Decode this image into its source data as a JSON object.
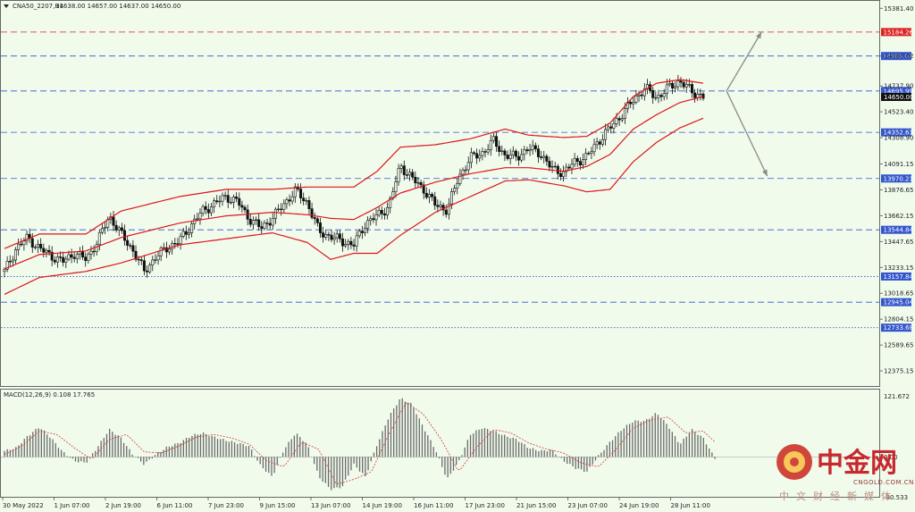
{
  "header": {
    "symbol": "CNA50_2207,H1",
    "ohlc": "14638.00 14657.00 14637.00 14650.00"
  },
  "colors": {
    "background": "#f0fbec",
    "bollinger": "#e0141b",
    "candle": "#111111",
    "macd_hist": "#6a6a6a",
    "macd_signal": "#d23c3c",
    "level_blue": "#3355cc",
    "level_red": "#dd2222",
    "arrow": "#8a8a8a"
  },
  "chart_data": [
    {
      "type": "line",
      "title": "",
      "description_series": [
        "price",
        "bollinger_upper",
        "bollinger_middle",
        "bollinger_lower"
      ],
      "ylim": [
        12250,
        15450
      ],
      "y_ticks": [
        "15381.40",
        "14985.62",
        "14737.90",
        "14523.40",
        "14308.90",
        "14091.15",
        "13876.65",
        "13662.15",
        "13447.65",
        "13233.15",
        "13018.65",
        "12804.15",
        "12589.65",
        "12375.15"
      ],
      "x_ticks": [
        "30 May 2022",
        "1 Jun 07:00",
        "2 Jun 19:00",
        "6 Jun 11:00",
        "7 Jun 23:00",
        "9 Jun 15:00",
        "13 Jun 07:00",
        "14 Jun 19:00",
        "16 Jun 11:00",
        "17 Jun 23:00",
        "21 Jun 15:00",
        "23 Jun 07:00",
        "24 Jun 19:00",
        "28 Jun 11:00"
      ],
      "levels": [
        {
          "value": 15184.26,
          "label": "15184.26",
          "style": "dashed",
          "color": "red"
        },
        {
          "value": 14985.62,
          "label": "14985.62",
          "style": "dashed",
          "color": "blue"
        },
        {
          "value": 14695.99,
          "label": "14695.99",
          "style": "dashed",
          "color": "blue"
        },
        {
          "value": 14352.61,
          "label": "14352.61",
          "style": "dashed",
          "color": "blue"
        },
        {
          "value": 13970.21,
          "label": "13970.21",
          "style": "dashed",
          "color": "blue"
        },
        {
          "value": 13544.84,
          "label": "13544.84",
          "style": "dashed",
          "color": "blue"
        },
        {
          "value": 13157.84,
          "label": "13157.84",
          "style": "dotted",
          "color": "blue"
        },
        {
          "value": 12945.04,
          "label": "12945.04",
          "style": "dashed",
          "color": "blue"
        },
        {
          "value": 12733.68,
          "label": "12733.68",
          "style": "dotted",
          "color": "blue"
        }
      ],
      "current_price": {
        "value": 14650.0,
        "label": "14650.00"
      },
      "price_path": [
        [
          0,
          13200
        ],
        [
          2,
          13390
        ],
        [
          4,
          13480
        ],
        [
          6,
          13390
        ],
        [
          8,
          13330
        ],
        [
          10,
          13280
        ],
        [
          12,
          13350
        ],
        [
          14,
          13300
        ],
        [
          16,
          13450
        ],
        [
          18,
          13660
        ],
        [
          20,
          13510
        ],
        [
          22,
          13380
        ],
        [
          24,
          13200
        ],
        [
          26,
          13320
        ],
        [
          28,
          13400
        ],
        [
          30,
          13450
        ],
        [
          32,
          13580
        ],
        [
          34,
          13700
        ],
        [
          36,
          13760
        ],
        [
          38,
          13820
        ],
        [
          40,
          13780
        ],
        [
          42,
          13640
        ],
        [
          44,
          13560
        ],
        [
          46,
          13640
        ],
        [
          48,
          13760
        ],
        [
          50,
          13870
        ],
        [
          52,
          13770
        ],
        [
          54,
          13530
        ],
        [
          56,
          13490
        ],
        [
          58,
          13450
        ],
        [
          60,
          13420
        ],
        [
          62,
          13600
        ],
        [
          64,
          13660
        ],
        [
          66,
          13740
        ],
        [
          68,
          14080
        ],
        [
          70,
          13970
        ],
        [
          72,
          13880
        ],
        [
          74,
          13750
        ],
        [
          76,
          13710
        ],
        [
          78,
          13980
        ],
        [
          80,
          14140
        ],
        [
          82,
          14180
        ],
        [
          84,
          14280
        ],
        [
          86,
          14160
        ],
        [
          88,
          14150
        ],
        [
          90,
          14220
        ],
        [
          92,
          14180
        ],
        [
          94,
          14050
        ],
        [
          96,
          14020
        ],
        [
          98,
          14110
        ],
        [
          100,
          14150
        ],
        [
          102,
          14280
        ],
        [
          104,
          14390
        ],
        [
          106,
          14500
        ],
        [
          108,
          14620
        ],
        [
          110,
          14720
        ],
        [
          112,
          14640
        ],
        [
          114,
          14720
        ],
        [
          116,
          14780
        ],
        [
          118,
          14690
        ],
        [
          120,
          14650
        ]
      ],
      "bollinger_upper": [
        [
          0,
          13390
        ],
        [
          6,
          13510
        ],
        [
          14,
          13510
        ],
        [
          20,
          13700
        ],
        [
          30,
          13820
        ],
        [
          38,
          13880
        ],
        [
          46,
          13880
        ],
        [
          52,
          13900
        ],
        [
          56,
          13900
        ],
        [
          60,
          13900
        ],
        [
          64,
          14030
        ],
        [
          68,
          14230
        ],
        [
          74,
          14250
        ],
        [
          80,
          14300
        ],
        [
          86,
          14380
        ],
        [
          90,
          14330
        ],
        [
          96,
          14310
        ],
        [
          100,
          14320
        ],
        [
          104,
          14430
        ],
        [
          108,
          14650
        ],
        [
          112,
          14760
        ],
        [
          116,
          14790
        ],
        [
          120,
          14760
        ]
      ],
      "bollinger_middle": [
        [
          0,
          13220
        ],
        [
          6,
          13340
        ],
        [
          14,
          13370
        ],
        [
          20,
          13480
        ],
        [
          30,
          13600
        ],
        [
          38,
          13660
        ],
        [
          46,
          13690
        ],
        [
          52,
          13670
        ],
        [
          56,
          13640
        ],
        [
          60,
          13630
        ],
        [
          64,
          13730
        ],
        [
          68,
          13850
        ],
        [
          74,
          13940
        ],
        [
          80,
          14010
        ],
        [
          86,
          14060
        ],
        [
          90,
          14060
        ],
        [
          96,
          14030
        ],
        [
          100,
          14070
        ],
        [
          104,
          14170
        ],
        [
          108,
          14380
        ],
        [
          112,
          14500
        ],
        [
          116,
          14600
        ],
        [
          120,
          14650
        ]
      ],
      "bollinger_lower": [
        [
          0,
          13010
        ],
        [
          6,
          13150
        ],
        [
          14,
          13200
        ],
        [
          20,
          13270
        ],
        [
          30,
          13420
        ],
        [
          38,
          13470
        ],
        [
          46,
          13520
        ],
        [
          52,
          13440
        ],
        [
          56,
          13300
        ],
        [
          60,
          13350
        ],
        [
          64,
          13350
        ],
        [
          68,
          13500
        ],
        [
          74,
          13690
        ],
        [
          80,
          13820
        ],
        [
          86,
          13950
        ],
        [
          90,
          13960
        ],
        [
          96,
          13910
        ],
        [
          100,
          13860
        ],
        [
          104,
          13880
        ],
        [
          108,
          14110
        ],
        [
          112,
          14270
        ],
        [
          116,
          14390
        ],
        [
          120,
          14470
        ]
      ],
      "forecast_arrows": [
        {
          "from": [
            124,
            14695.99
          ],
          "to": [
            130,
            15184.26
          ],
          "direction": "up"
        },
        {
          "from": [
            124,
            14695.99
          ],
          "to": [
            131,
            13990
          ],
          "direction": "down"
        }
      ]
    },
    {
      "type": "bar",
      "title": "MACD(12,26,9) 0.108 17.765",
      "ylim": [
        -80,
        135
      ],
      "y_ticks": [
        "121.672",
        "0.00",
        "-80.533"
      ],
      "histogram_path": [
        [
          0,
          12
        ],
        [
          2,
          18
        ],
        [
          4,
          42
        ],
        [
          6,
          60
        ],
        [
          8,
          38
        ],
        [
          10,
          10
        ],
        [
          12,
          -8
        ],
        [
          14,
          -12
        ],
        [
          16,
          20
        ],
        [
          18,
          55
        ],
        [
          20,
          38
        ],
        [
          22,
          5
        ],
        [
          24,
          -15
        ],
        [
          26,
          5
        ],
        [
          28,
          20
        ],
        [
          30,
          28
        ],
        [
          32,
          42
        ],
        [
          34,
          48
        ],
        [
          36,
          40
        ],
        [
          38,
          33
        ],
        [
          40,
          28
        ],
        [
          42,
          22
        ],
        [
          44,
          -18
        ],
        [
          46,
          -40
        ],
        [
          48,
          15
        ],
        [
          50,
          48
        ],
        [
          52,
          25
        ],
        [
          54,
          -40
        ],
        [
          56,
          -65
        ],
        [
          58,
          -60
        ],
        [
          60,
          -15
        ],
        [
          62,
          -40
        ],
        [
          64,
          25
        ],
        [
          66,
          80
        ],
        [
          68,
          118
        ],
        [
          70,
          105
        ],
        [
          72,
          58
        ],
        [
          74,
          15
        ],
        [
          76,
          -45
        ],
        [
          78,
          -10
        ],
        [
          80,
          45
        ],
        [
          82,
          58
        ],
        [
          84,
          52
        ],
        [
          86,
          42
        ],
        [
          88,
          35
        ],
        [
          90,
          18
        ],
        [
          92,
          12
        ],
        [
          94,
          14
        ],
        [
          96,
          -8
        ],
        [
          98,
          -22
        ],
        [
          100,
          -30
        ],
        [
          102,
          2
        ],
        [
          104,
          30
        ],
        [
          106,
          55
        ],
        [
          108,
          72
        ],
        [
          110,
          72
        ],
        [
          112,
          88
        ],
        [
          114,
          62
        ],
        [
          116,
          25
        ],
        [
          118,
          55
        ],
        [
          120,
          38
        ],
        [
          122,
          -3
        ]
      ],
      "signal_path": [
        [
          0,
          5
        ],
        [
          3,
          22
        ],
        [
          6,
          52
        ],
        [
          9,
          45
        ],
        [
          12,
          18
        ],
        [
          15,
          -5
        ],
        [
          18,
          35
        ],
        [
          21,
          45
        ],
        [
          24,
          10
        ],
        [
          27,
          8
        ],
        [
          30,
          22
        ],
        [
          33,
          40
        ],
        [
          36,
          45
        ],
        [
          39,
          38
        ],
        [
          42,
          26
        ],
        [
          45,
          -8
        ],
        [
          48,
          -20
        ],
        [
          51,
          30
        ],
        [
          54,
          15
        ],
        [
          57,
          -55
        ],
        [
          60,
          -45
        ],
        [
          63,
          -30
        ],
        [
          66,
          45
        ],
        [
          69,
          110
        ],
        [
          72,
          85
        ],
        [
          75,
          35
        ],
        [
          78,
          -30
        ],
        [
          81,
          18
        ],
        [
          84,
          55
        ],
        [
          87,
          48
        ],
        [
          90,
          28
        ],
        [
          93,
          16
        ],
        [
          96,
          8
        ],
        [
          99,
          -12
        ],
        [
          102,
          -20
        ],
        [
          105,
          15
        ],
        [
          108,
          58
        ],
        [
          111,
          74
        ],
        [
          114,
          80
        ],
        [
          117,
          48
        ],
        [
          120,
          52
        ],
        [
          122,
          30
        ]
      ]
    }
  ],
  "watermark": {
    "brand_cn": "中金网",
    "brand_en": "CNGOLD.COM.CN",
    "tagline": "中文财经新媒体"
  }
}
